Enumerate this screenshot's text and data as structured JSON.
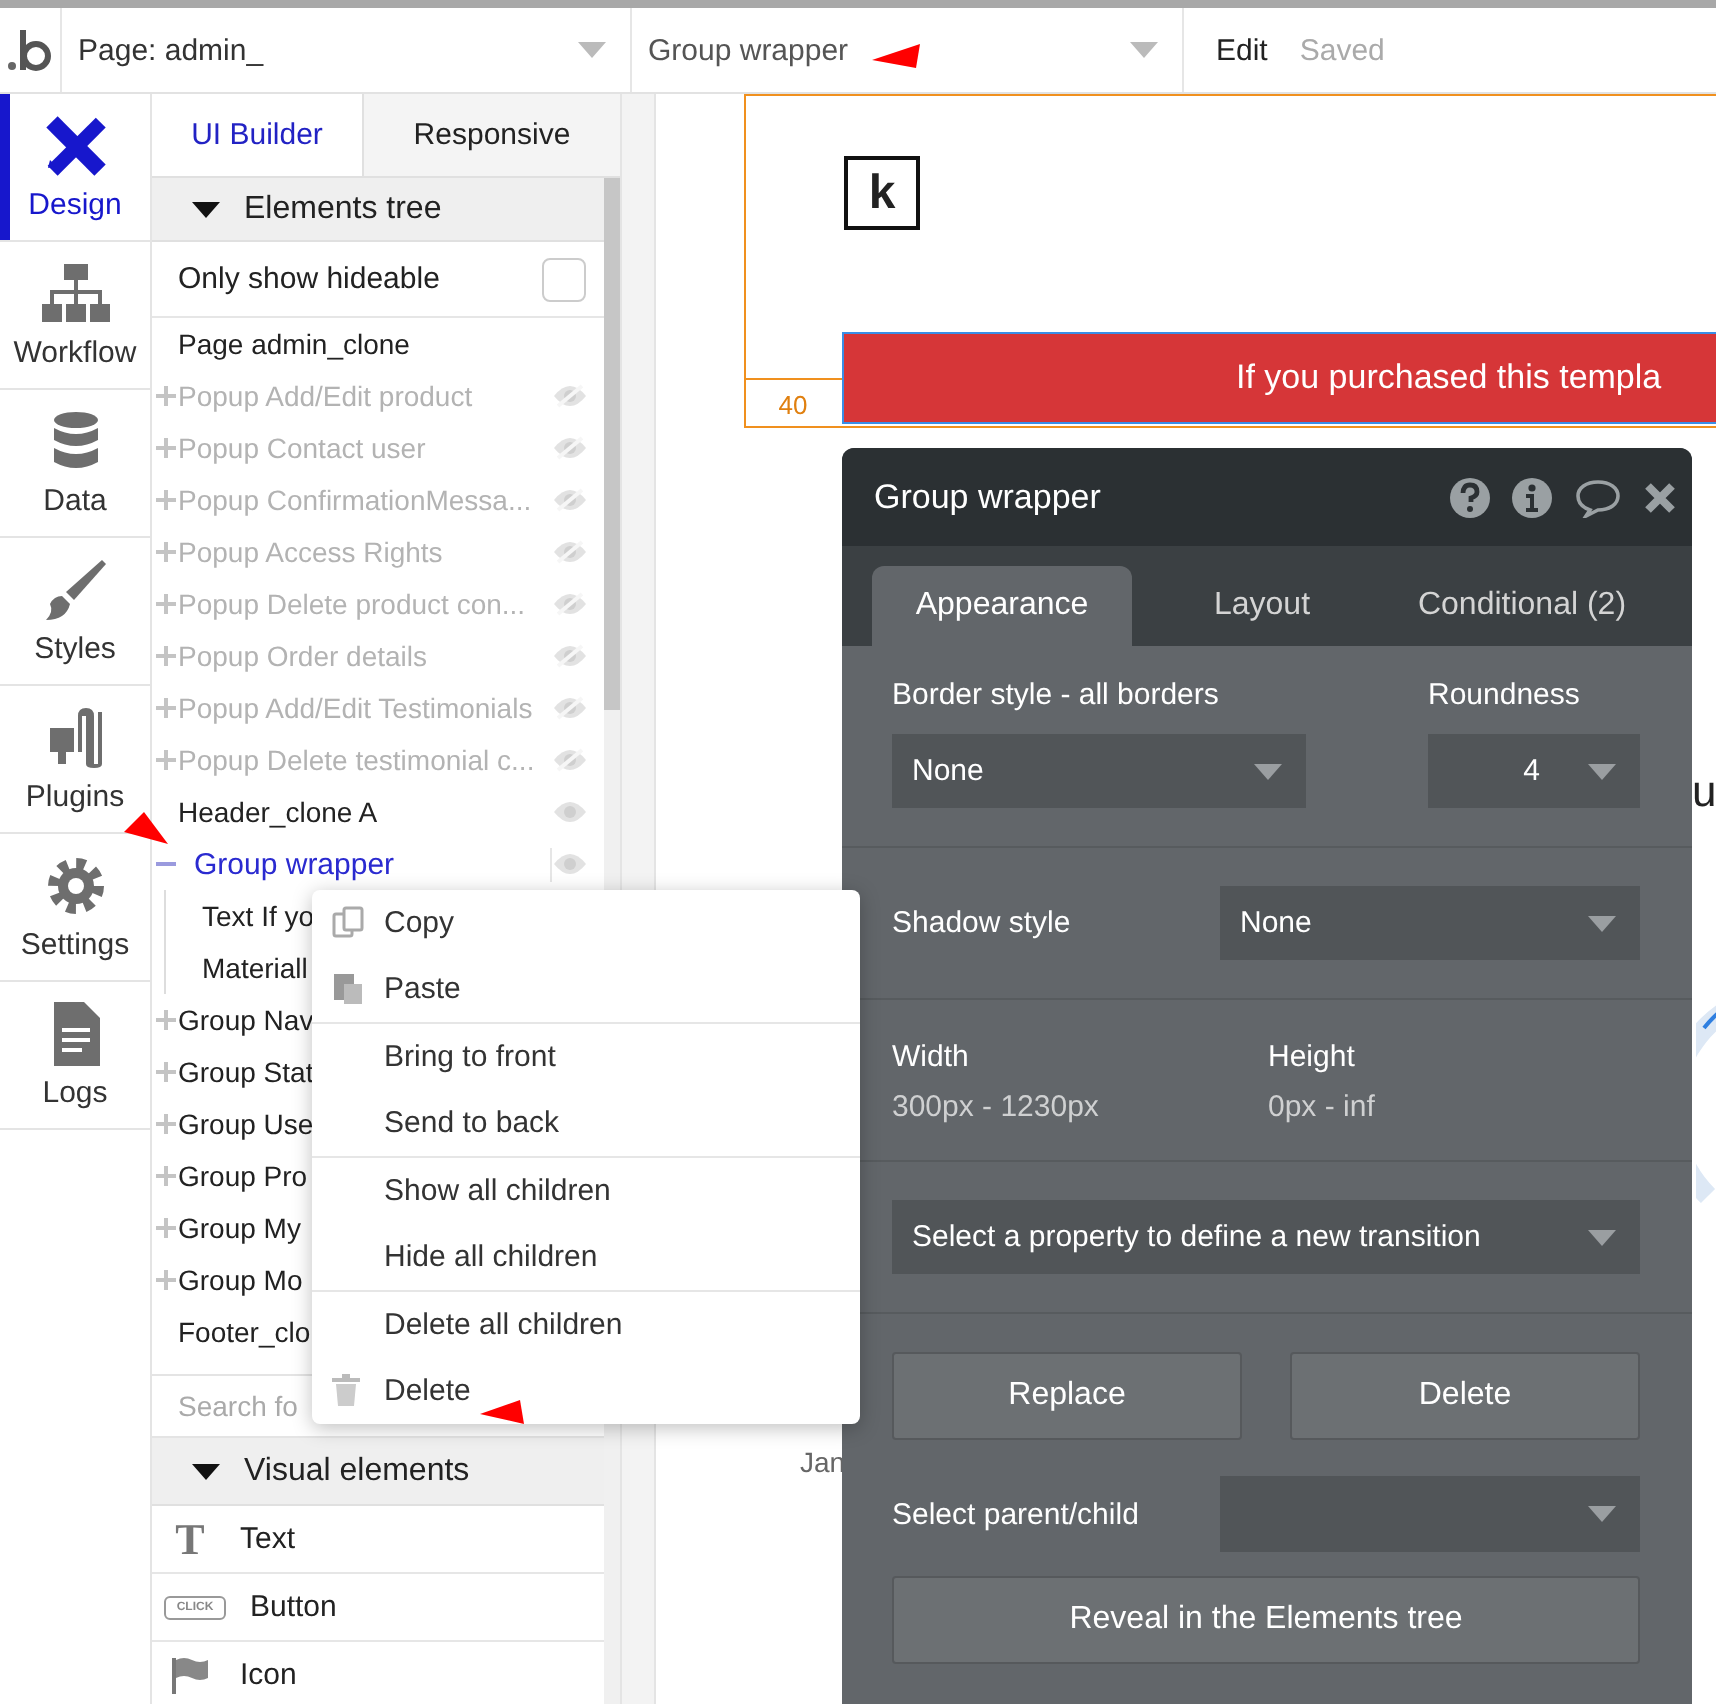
{
  "top_bar": {
    "page_selector": "Page: admin_",
    "element_selector": "Group wrapper",
    "menu": [
      "Edit"
    ],
    "status": "Saved"
  },
  "nav": [
    {
      "label": "Design",
      "kind": "design",
      "selected": true
    },
    {
      "label": "Workflow",
      "kind": "workflow",
      "selected": false
    },
    {
      "label": "Data",
      "kind": "data",
      "selected": false
    },
    {
      "label": "Styles",
      "kind": "styles",
      "selected": false
    },
    {
      "label": "Plugins",
      "kind": "plugins",
      "selected": false
    },
    {
      "label": "Settings",
      "kind": "settings",
      "selected": false
    },
    {
      "label": "Logs",
      "kind": "logs",
      "selected": false
    }
  ],
  "panel_tabs": [
    {
      "label": "UI Builder",
      "selected": true
    },
    {
      "label": "Responsive",
      "selected": false
    }
  ],
  "elements_tree": {
    "title": "Elements tree",
    "expanded": true,
    "filter": {
      "label": "Only show hideable",
      "checked": false
    },
    "items": [
      {
        "label": "Page admin_clone",
        "kind": "page",
        "selected": false
      },
      {
        "label": "Popup Add/Edit product",
        "kind": "group",
        "expanded": false,
        "hidden": true,
        "selected": false
      },
      {
        "label": "Popup Contact user",
        "kind": "group",
        "expanded": false,
        "hidden": true,
        "selected": false
      },
      {
        "label": "Popup ConfirmationMessa...",
        "kind": "group",
        "expanded": false,
        "hidden": true,
        "selected": false
      },
      {
        "label": "Popup Access Rights",
        "kind": "group",
        "expanded": false,
        "hidden": true,
        "selected": false
      },
      {
        "label": "Popup Delete product con...",
        "kind": "group",
        "expanded": false,
        "hidden": true,
        "selected": false
      },
      {
        "label": "Popup Order details",
        "kind": "group",
        "expanded": false,
        "hidden": true,
        "selected": false
      },
      {
        "label": "Popup Add/Edit Testimonials",
        "kind": "group",
        "expanded": false,
        "hidden": true,
        "selected": false
      },
      {
        "label": "Popup Delete testimonial c...",
        "kind": "group",
        "expanded": false,
        "hidden": true,
        "selected": false
      },
      {
        "label": "Header_clone A",
        "kind": "leaf",
        "hidden": false,
        "selected": false
      },
      {
        "label": "Group wrapper",
        "kind": "group",
        "expanded": true,
        "hidden": false,
        "selected": true,
        "children": [
          {
            "label": "Text If yo",
            "selected": false
          },
          {
            "label": "Materiall",
            "selected": false
          }
        ]
      },
      {
        "label": "Group Nav",
        "kind": "group",
        "expanded": false,
        "selected": false
      },
      {
        "label": "Group Stat",
        "kind": "group",
        "expanded": false,
        "selected": false
      },
      {
        "label": "Group Use",
        "kind": "group",
        "expanded": false,
        "selected": false
      },
      {
        "label": "Group Pro",
        "kind": "group",
        "expanded": false,
        "selected": false
      },
      {
        "label": "Group My",
        "kind": "group",
        "expanded": false,
        "selected": false
      },
      {
        "label": "Group Mo",
        "kind": "group",
        "expanded": false,
        "selected": false
      },
      {
        "label": "Footer_clo",
        "kind": "leaf",
        "selected": false
      }
    ],
    "search": {
      "placeholder": "Search fo"
    }
  },
  "visual_elements": {
    "title": "Visual elements",
    "expanded": true,
    "items": [
      {
        "label": "Text",
        "kind": "text",
        "glyph": "T"
      },
      {
        "label": "Button",
        "kind": "button",
        "glyph": "CLICK"
      },
      {
        "label": "Icon",
        "kind": "icon"
      }
    ]
  },
  "canvas": {
    "logo_letter": "k",
    "banner": "If you purchased this templa",
    "ruler_value": "40",
    "fragments": [
      "u",
      "Jan"
    ]
  },
  "property_editor": {
    "title": "Group wrapper",
    "tabs": [
      {
        "label": "Appearance",
        "selected": true
      },
      {
        "label": "Layout",
        "selected": false
      },
      {
        "label": "Conditional (2)",
        "selected": false
      }
    ],
    "border_style": {
      "label": "Border style - all borders",
      "value": "None"
    },
    "roundness": {
      "label": "Roundness",
      "value": "4"
    },
    "shadow_style": {
      "label": "Shadow style",
      "value": "None"
    },
    "width": {
      "label": "Width",
      "value": "300px - 1230px"
    },
    "height": {
      "label": "Height",
      "value": "0px - inf"
    },
    "transition": {
      "value": "Select a property to define a new transition"
    },
    "buttons": [
      "Replace",
      "Delete"
    ],
    "parent_child": {
      "label": "Select parent/child"
    },
    "reveal_button": "Reveal in the Elements tree"
  },
  "context_menu": {
    "groups": [
      [
        {
          "label": "Copy",
          "kind": "copy"
        },
        {
          "label": "Paste",
          "kind": "paste"
        }
      ],
      [
        {
          "label": "Bring to front",
          "kind": "plain"
        },
        {
          "label": "Send to back",
          "kind": "plain"
        }
      ],
      [
        {
          "label": "Show all children",
          "kind": "plain"
        },
        {
          "label": "Hide all children",
          "kind": "plain"
        }
      ],
      [
        {
          "label": "Delete all children",
          "kind": "plain"
        },
        {
          "label": "Delete",
          "kind": "delete"
        }
      ]
    ]
  }
}
